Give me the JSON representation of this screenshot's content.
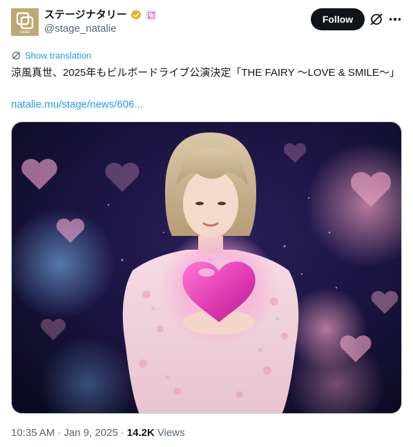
{
  "account": {
    "display_name": "ステージナタリー",
    "handle": "@stage_natalie",
    "avatar_text": "natalie"
  },
  "actions": {
    "follow_label": "Follow"
  },
  "tweet": {
    "show_translation": "Show translation",
    "text": "涼風真世、2025年もビルボードライブ公演決定「THE FAIRY ～LOVE & SMILE～」",
    "link": "natalie.mu/stage/news/606...",
    "time": "10:35 AM",
    "date": "Jan 9, 2025",
    "views_count": "14.2K",
    "views_label": "Views"
  },
  "colors": {
    "link_blue": "#1d9bf0",
    "verified_gold": "#e8b021",
    "avatar_bg": "#bfa772",
    "follow_bg": "#0f1419",
    "muted": "#536471"
  },
  "icons": {
    "verified": "verified-badge-icon",
    "affiliate": "affiliate-badge-icon",
    "grok": "grok-icon",
    "more": "more-icon",
    "translate": "translate-icon"
  }
}
